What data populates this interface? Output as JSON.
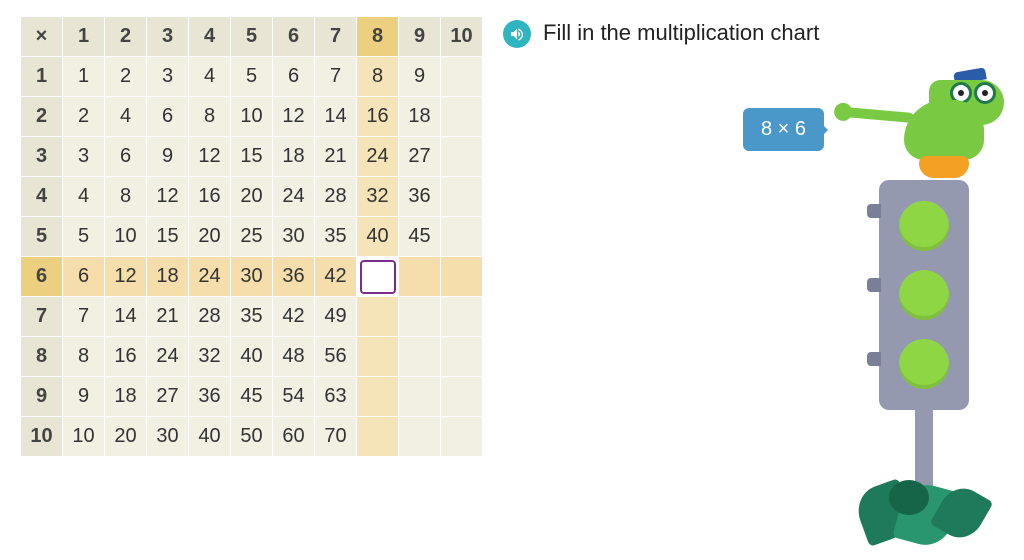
{
  "instruction": "Fill in the multiplication chart",
  "speech": "8 × 6",
  "highlight": {
    "row": 6,
    "col": 8
  },
  "input_cell": {
    "row": 6,
    "col": 8
  },
  "chart": {
    "symbol": "×",
    "size": 10,
    "rows": [
      {
        "label": "1",
        "cells": [
          "1",
          "2",
          "3",
          "4",
          "5",
          "6",
          "7",
          "8",
          "9",
          ""
        ]
      },
      {
        "label": "2",
        "cells": [
          "2",
          "4",
          "6",
          "8",
          "10",
          "12",
          "14",
          "16",
          "18",
          ""
        ]
      },
      {
        "label": "3",
        "cells": [
          "3",
          "6",
          "9",
          "12",
          "15",
          "18",
          "21",
          "24",
          "27",
          ""
        ]
      },
      {
        "label": "4",
        "cells": [
          "4",
          "8",
          "12",
          "16",
          "20",
          "24",
          "28",
          "32",
          "36",
          ""
        ]
      },
      {
        "label": "5",
        "cells": [
          "5",
          "10",
          "15",
          "20",
          "25",
          "30",
          "35",
          "40",
          "45",
          ""
        ]
      },
      {
        "label": "6",
        "cells": [
          "6",
          "12",
          "18",
          "24",
          "30",
          "36",
          "42",
          "",
          "",
          ""
        ]
      },
      {
        "label": "7",
        "cells": [
          "7",
          "14",
          "21",
          "28",
          "35",
          "42",
          "49",
          "",
          "",
          ""
        ]
      },
      {
        "label": "8",
        "cells": [
          "8",
          "16",
          "24",
          "32",
          "40",
          "48",
          "56",
          "",
          "",
          ""
        ]
      },
      {
        "label": "9",
        "cells": [
          "9",
          "18",
          "27",
          "36",
          "45",
          "54",
          "63",
          "",
          "",
          ""
        ]
      },
      {
        "label": "10",
        "cells": [
          "10",
          "20",
          "30",
          "40",
          "50",
          "60",
          "70",
          "",
          "",
          ""
        ]
      }
    ]
  },
  "colors": {
    "accent": "#2fb4c2",
    "bubble": "#4a97c9",
    "input_border": "#7a2e8a"
  }
}
